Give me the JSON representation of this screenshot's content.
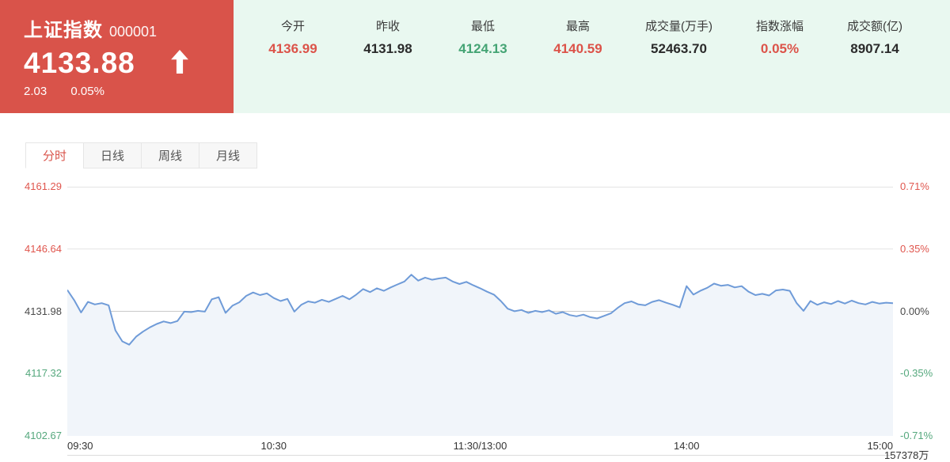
{
  "header": {
    "index_name": "上证指数",
    "index_code": "000001",
    "price": "4133.88",
    "change": "2.03",
    "change_pct": "0.05%",
    "direction": "up",
    "stats": [
      {
        "label": "今开",
        "value": "4136.99",
        "tone": "up"
      },
      {
        "label": "昨收",
        "value": "4131.98",
        "tone": "flat"
      },
      {
        "label": "最低",
        "value": "4124.13",
        "tone": "down"
      },
      {
        "label": "最高",
        "value": "4140.59",
        "tone": "up"
      },
      {
        "label": "成交量(万手)",
        "value": "52463.70",
        "tone": "flat"
      },
      {
        "label": "指数涨幅",
        "value": "0.05%",
        "tone": "up"
      },
      {
        "label": "成交额(亿)",
        "value": "8907.14",
        "tone": "flat"
      }
    ]
  },
  "tabs": [
    {
      "key": "minute",
      "label": "分时",
      "active": true
    },
    {
      "key": "daily",
      "label": "日线",
      "active": false
    },
    {
      "key": "weekly",
      "label": "周线",
      "active": false
    },
    {
      "key": "monthly",
      "label": "月线",
      "active": false
    }
  ],
  "chart_data": {
    "type": "line",
    "title": "上证指数 分时走势",
    "ylim": [
      4102.67,
      4161.29
    ],
    "baseline": 4131.98,
    "grid": true,
    "y_axis_left": [
      {
        "text": "4161.29",
        "tone": "up"
      },
      {
        "text": "4146.64",
        "tone": "up"
      },
      {
        "text": "4131.98",
        "tone": "flat"
      },
      {
        "text": "4117.32",
        "tone": "down"
      },
      {
        "text": "4102.67",
        "tone": "down"
      }
    ],
    "y_axis_right": [
      {
        "text": "0.71%",
        "tone": "up"
      },
      {
        "text": "0.35%",
        "tone": "up"
      },
      {
        "text": "0.00%",
        "tone": "flat"
      },
      {
        "text": "-0.35%",
        "tone": "down"
      },
      {
        "text": "-0.71%",
        "tone": "down"
      }
    ],
    "x_ticks": [
      {
        "text": "09:30",
        "pos": 0,
        "align": "left"
      },
      {
        "text": "10:30",
        "pos": 0.25,
        "align": "center"
      },
      {
        "text": "11:30/13:00",
        "pos": 0.5,
        "align": "center"
      },
      {
        "text": "14:00",
        "pos": 0.75,
        "align": "center"
      },
      {
        "text": "15:00",
        "pos": 1,
        "align": "right"
      }
    ],
    "session_minutes": 240,
    "step_minutes": 2,
    "values": [
      4137.0,
      4134.6,
      4131.7,
      4134.2,
      4133.6,
      4133.9,
      4133.4,
      4127.5,
      4124.9,
      4124.13,
      4126.0,
      4127.2,
      4128.2,
      4129.0,
      4129.6,
      4129.2,
      4129.7,
      4131.9,
      4131.8,
      4132.1,
      4131.9,
      4134.8,
      4135.3,
      4131.6,
      4133.3,
      4134.1,
      4135.6,
      4136.4,
      4135.8,
      4136.2,
      4135.1,
      4134.4,
      4134.9,
      4131.9,
      4133.5,
      4134.3,
      4134.0,
      4134.7,
      4134.2,
      4134.9,
      4135.6,
      4134.8,
      4135.9,
      4137.2,
      4136.5,
      4137.4,
      4136.8,
      4137.6,
      4138.3,
      4139.0,
      4140.59,
      4139.2,
      4139.9,
      4139.4,
      4139.7,
      4139.9,
      4139.0,
      4138.4,
      4138.9,
      4138.1,
      4137.4,
      4136.6,
      4135.9,
      4134.4,
      4132.6,
      4132.0,
      4132.3,
      4131.6,
      4132.1,
      4131.8,
      4132.2,
      4131.4,
      4131.8,
      4131.1,
      4130.8,
      4131.2,
      4130.6,
      4130.3,
      4130.9,
      4131.5,
      4132.8,
      4133.9,
      4134.3,
      4133.6,
      4133.4,
      4134.2,
      4134.6,
      4134.0,
      4133.5,
      4132.9,
      4137.9,
      4135.9,
      4136.8,
      4137.5,
      4138.5,
      4138.0,
      4138.2,
      4137.6,
      4137.9,
      4136.6,
      4135.8,
      4136.1,
      4135.7,
      4136.9,
      4137.1,
      4136.8,
      4133.9,
      4132.1,
      4134.4,
      4133.5,
      4134.1,
      4133.7,
      4134.4,
      4133.8,
      4134.5,
      4133.9,
      4133.6,
      4134.2,
      4133.8,
      4134.0,
      4133.88
    ],
    "volume_axis_label": "157378万"
  },
  "colors": {
    "accent_red": "#d9534a",
    "value_red": "#dc5349",
    "value_green": "#44a474",
    "label_red": "#e0564e",
    "label_green": "#55a87d",
    "mint_bg": "#e9f8f0",
    "line_blue": "#6f9bd8",
    "area_fill": "#f1f5fa",
    "grid": "#e4e4e4",
    "grid_mid": "#c9c9c9"
  }
}
